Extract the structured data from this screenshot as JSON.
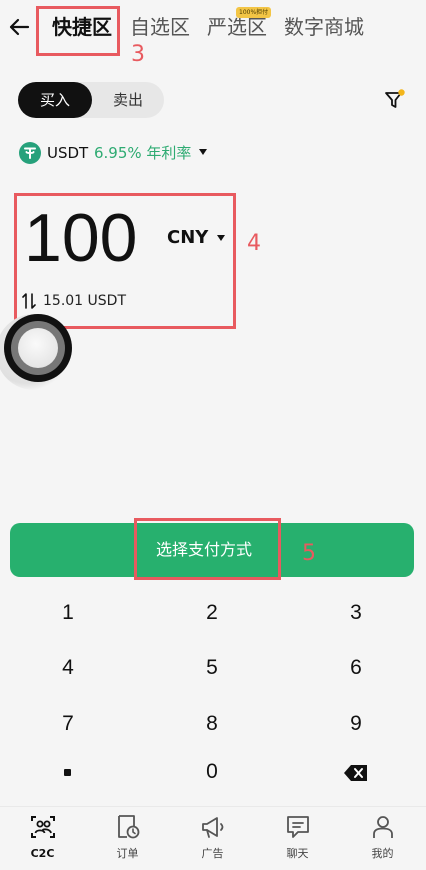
{
  "header": {
    "tabs": [
      {
        "label": "快捷区",
        "active": true
      },
      {
        "label": "自选区",
        "active": false
      },
      {
        "label": "严选区",
        "active": false,
        "badge": "100%担付"
      },
      {
        "label": "数字商城",
        "active": false
      }
    ]
  },
  "annotations": {
    "tab_marker": "3",
    "amount_marker": "4",
    "pay_marker": "5",
    "color": "#e85a5f"
  },
  "trade_toggle": {
    "buy_label": "买入",
    "sell_label": "卖出",
    "selected": "buy"
  },
  "coin": {
    "name": "USDT",
    "rate": "6.95% 年利率",
    "icon": "tether-icon"
  },
  "amount": {
    "value": "100",
    "currency": "CNY",
    "conversion": "15.01 USDT"
  },
  "pay_button": {
    "label": "选择支付方式",
    "color": "#27b06e"
  },
  "keypad": {
    "keys": [
      "1",
      "2",
      "3",
      "4",
      "5",
      "6",
      "7",
      "8",
      "9",
      "0"
    ],
    "decimal_icon": "dot-icon",
    "delete_icon": "backspace-icon"
  },
  "bottom_nav": [
    {
      "label": "C2C",
      "icon": "c2c-icon",
      "active": true
    },
    {
      "label": "订单",
      "icon": "order-icon",
      "active": false
    },
    {
      "label": "广告",
      "icon": "megaphone-icon",
      "active": false
    },
    {
      "label": "聊天",
      "icon": "chat-icon",
      "active": false
    },
    {
      "label": "我的",
      "icon": "profile-icon",
      "active": false
    }
  ]
}
